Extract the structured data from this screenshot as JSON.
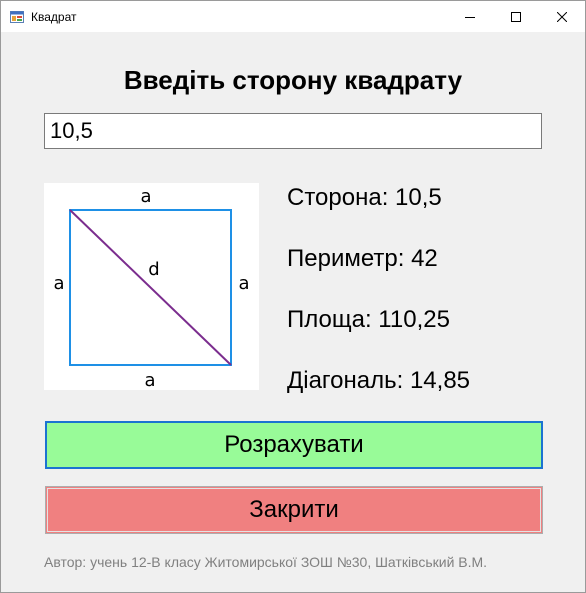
{
  "window": {
    "title": "Квадрат",
    "icons": {
      "app": "app-form-icon",
      "minimize": "minimize-icon",
      "maximize": "maximize-icon",
      "close": "close-icon"
    }
  },
  "form": {
    "heading": "Введіть сторону квадрату",
    "side_input_value": "10,5"
  },
  "diagram": {
    "label_top": "a",
    "label_left": "a",
    "label_right": "a",
    "label_bottom": "a",
    "label_diagonal": "d",
    "colors": {
      "square_stroke": "#1e90e6",
      "diagonal_stroke": "#7b2d8e"
    }
  },
  "results": {
    "side": "Сторона: 10,5",
    "perimeter": "Периметр: 42",
    "area": "Площа: 110,25",
    "diagonal": "Діагональ: 14,85"
  },
  "buttons": {
    "calculate_label": "Розрахувати",
    "close_label": "Закрити",
    "colors": {
      "calculate_bg": "#98fb98",
      "close_bg": "#f08080"
    }
  },
  "footer": {
    "author": "Автор: учень 12-В класу Житомирської ЗОШ №30, Шатківський В.М."
  }
}
